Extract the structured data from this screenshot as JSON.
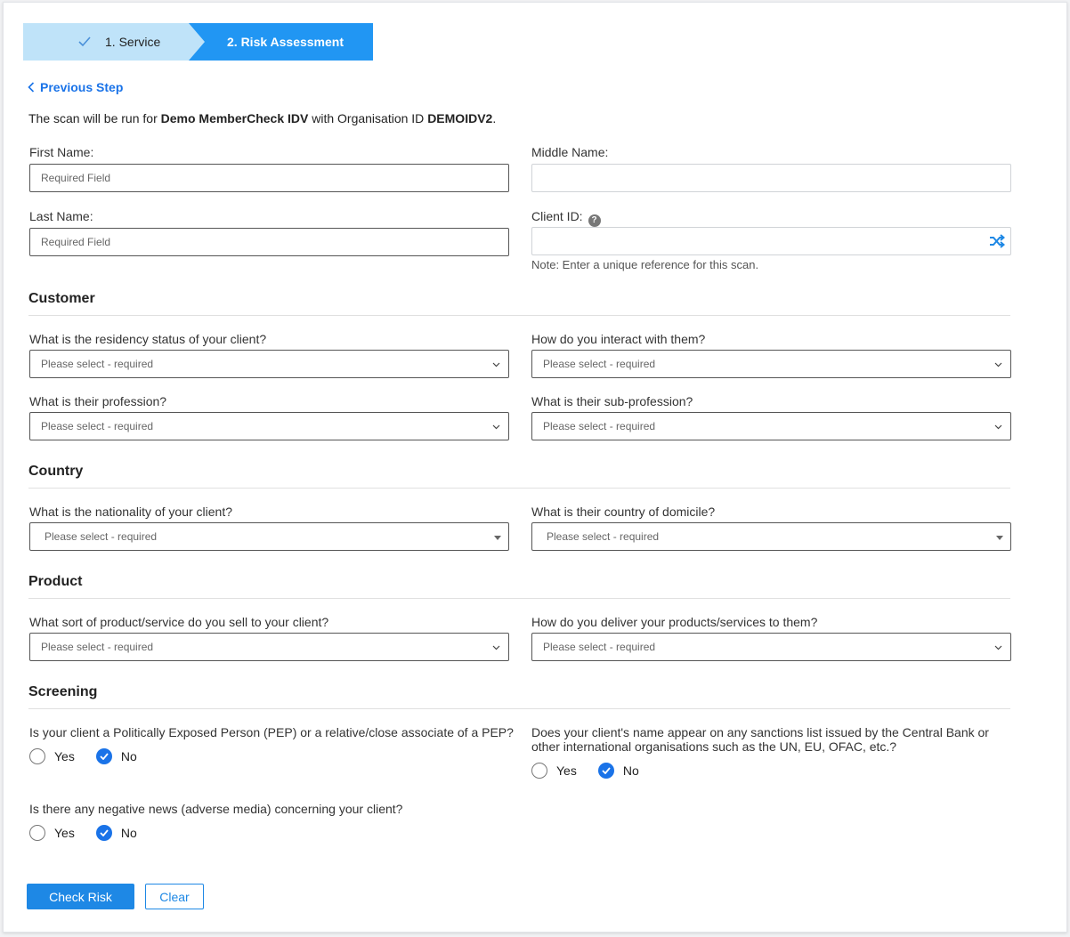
{
  "stepper": {
    "step1": "1. Service",
    "step2": "2. Risk Assessment"
  },
  "nav": {
    "previous_step": "Previous Step"
  },
  "scan_info": {
    "prefix": "The scan will be run for ",
    "org_name": "Demo MemberCheck IDV",
    "middle": " with Organisation ID ",
    "org_id": "DEMOIDV2",
    "suffix": "."
  },
  "fields": {
    "first_name": {
      "label": "First Name:",
      "placeholder": "Required Field"
    },
    "middle_name": {
      "label": "Middle Name:",
      "placeholder": ""
    },
    "last_name": {
      "label": "Last Name:",
      "placeholder": "Required Field"
    },
    "client_id": {
      "label": "Client ID:",
      "placeholder": "",
      "note": "Note: Enter a unique reference for this scan.",
      "help": "?"
    }
  },
  "sections": {
    "customer": {
      "title": "Customer",
      "residency": {
        "label": "What is the residency status of your client?",
        "value": "Please select - required"
      },
      "interact": {
        "label": "How do you interact with them?",
        "value": "Please select - required"
      },
      "profession": {
        "label": "What is their profession?",
        "value": "Please select - required"
      },
      "sub_profession": {
        "label": "What is their sub-profession?",
        "value": "Please select - required"
      }
    },
    "country": {
      "title": "Country",
      "nationality": {
        "label": "What is the nationality of your client?",
        "value": "Please select - required"
      },
      "domicile": {
        "label": "What is their country of domicile?",
        "value": "Please select - required"
      }
    },
    "product": {
      "title": "Product",
      "product_sold": {
        "label": "What sort of product/service do you sell to your client?",
        "value": "Please select - required"
      },
      "delivery": {
        "label": "How do you deliver your products/services to them?",
        "value": "Please select - required"
      }
    },
    "screening": {
      "title": "Screening",
      "pep": {
        "label": "Is your client a Politically Exposed Person (PEP) or a relative/close associate of a PEP?",
        "yes": "Yes",
        "no": "No",
        "selected": "No"
      },
      "sanctions": {
        "label_line1": "Does your client's name appear on any sanctions list issued by the Central Bank or",
        "label_line2": "other international organisations such as the UN, EU, OFAC, etc.?",
        "yes": "Yes",
        "no": "No",
        "selected": "No"
      },
      "adverse": {
        "label": "Is there any negative news (adverse media) concerning your client?",
        "yes": "Yes",
        "no": "No",
        "selected": "No"
      }
    }
  },
  "buttons": {
    "check_risk": "Check Risk",
    "clear": "Clear"
  },
  "colors": {
    "accent": "#2196f3",
    "step_done": "#bfe3f9",
    "link": "#1a73e8"
  }
}
